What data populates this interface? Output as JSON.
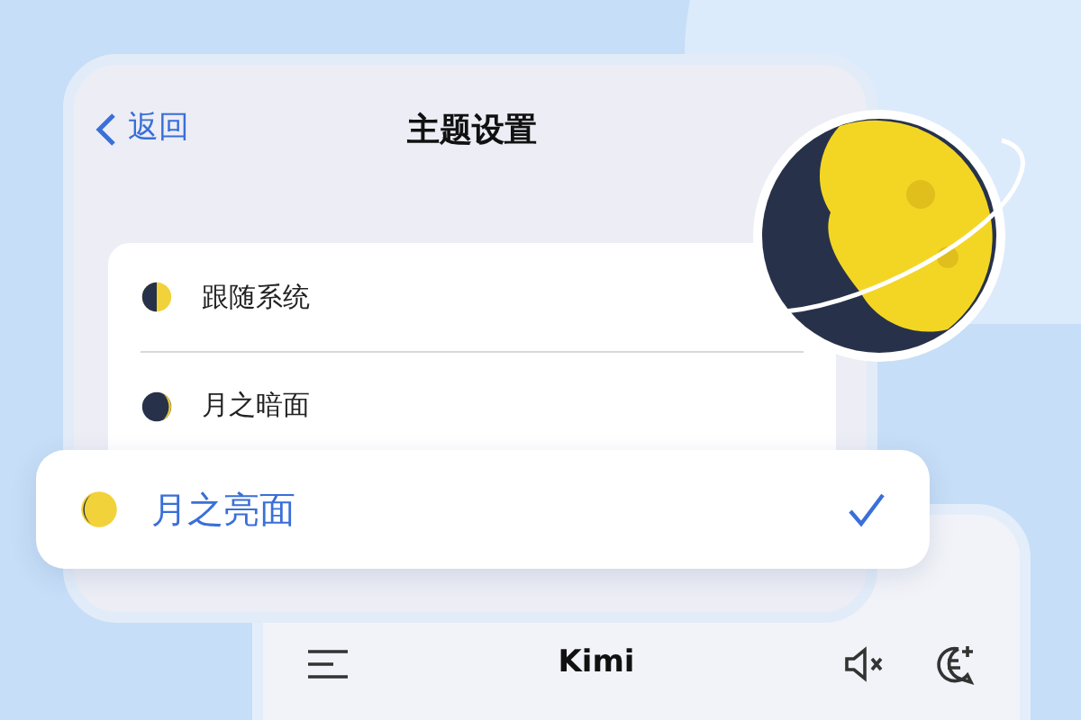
{
  "settings_window": {
    "back_label": "返回",
    "title": "主题设置"
  },
  "options": [
    {
      "label": "跟随系统",
      "kind": "half",
      "selected": false
    },
    {
      "label": "月之暗面",
      "kind": "dark",
      "selected": false
    },
    {
      "label": "月之亮面",
      "kind": "light",
      "selected": true
    }
  ],
  "chat_window": {
    "title": "Kimi"
  }
}
